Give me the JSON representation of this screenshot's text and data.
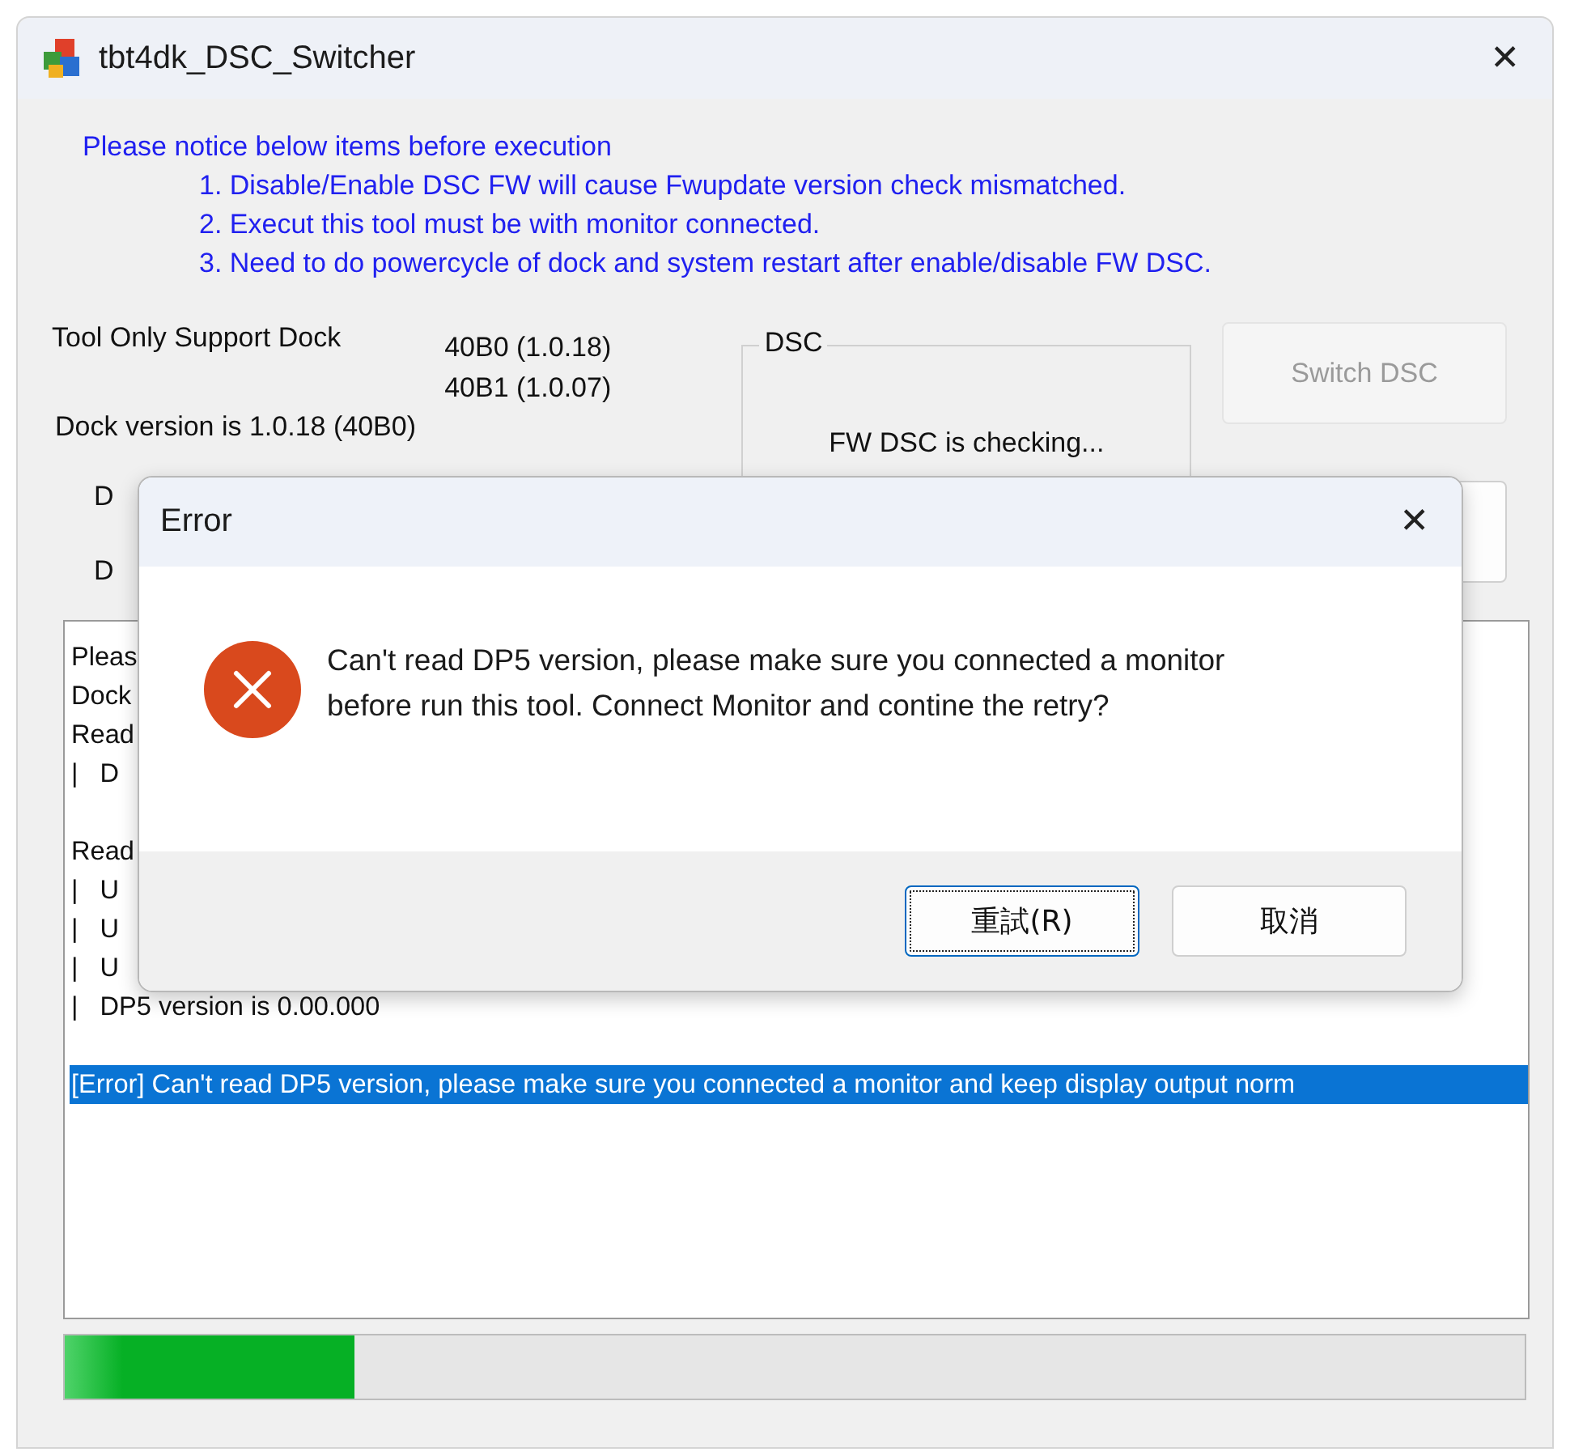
{
  "window": {
    "title": "tbt4dk_DSC_Switcher",
    "close": "✕"
  },
  "notice": {
    "heading": "Please notice below items before execution",
    "items": [
      "1. Disable/Enable DSC FW will cause Fwupdate version check mismatched.",
      "2. Execut this tool must be with monitor connected.",
      "3. Need to do powercycle of dock and system restart after enable/disable FW DSC."
    ]
  },
  "support": {
    "label": "Tool Only Support Dock",
    "versions": [
      "40B0 (1.0.18)",
      "40B1 (1.0.07)"
    ]
  },
  "dock_version": "Dock version is 1.0.18 (40B0)",
  "dsc_group": {
    "title": "DSC",
    "status": "FW DSC is checking..."
  },
  "buttons": [
    {
      "label": "Switch DSC",
      "disabled": true
    },
    {
      "disabled": false
    }
  ],
  "row_labels": [
    "D",
    "D"
  ],
  "log": [
    {
      "text": "Pleas",
      "selected": false
    },
    {
      "text": "Dock",
      "selected": false
    },
    {
      "text": "Read",
      "selected": false
    },
    {
      "text": "|   D",
      "selected": false
    },
    {
      "selected": false
    },
    {
      "text": "Read",
      "selected": false
    },
    {
      "text": "|   U",
      "selected": false
    },
    {
      "text": "|   U",
      "selected": false
    },
    {
      "text": "|   U",
      "selected": false
    },
    {
      "text": "|   DP5 version is 0.00.000",
      "selected": false
    },
    {
      "selected": false
    },
    {
      "text": "[Error] Can't read DP5 version, please make sure you connected a monitor and keep display output norm",
      "selected": true
    }
  ],
  "progress": {
    "level": 0.198
  },
  "dialog": {
    "title": "Error",
    "close": "✕",
    "message": "Can't read DP5 version, please make sure you connected a monitor before run this tool. Connect Monitor and contine the retry?",
    "buttons": [
      {
        "label": "重試(R)",
        "focused": true
      },
      {
        "label": "取消",
        "focused": false
      }
    ]
  }
}
